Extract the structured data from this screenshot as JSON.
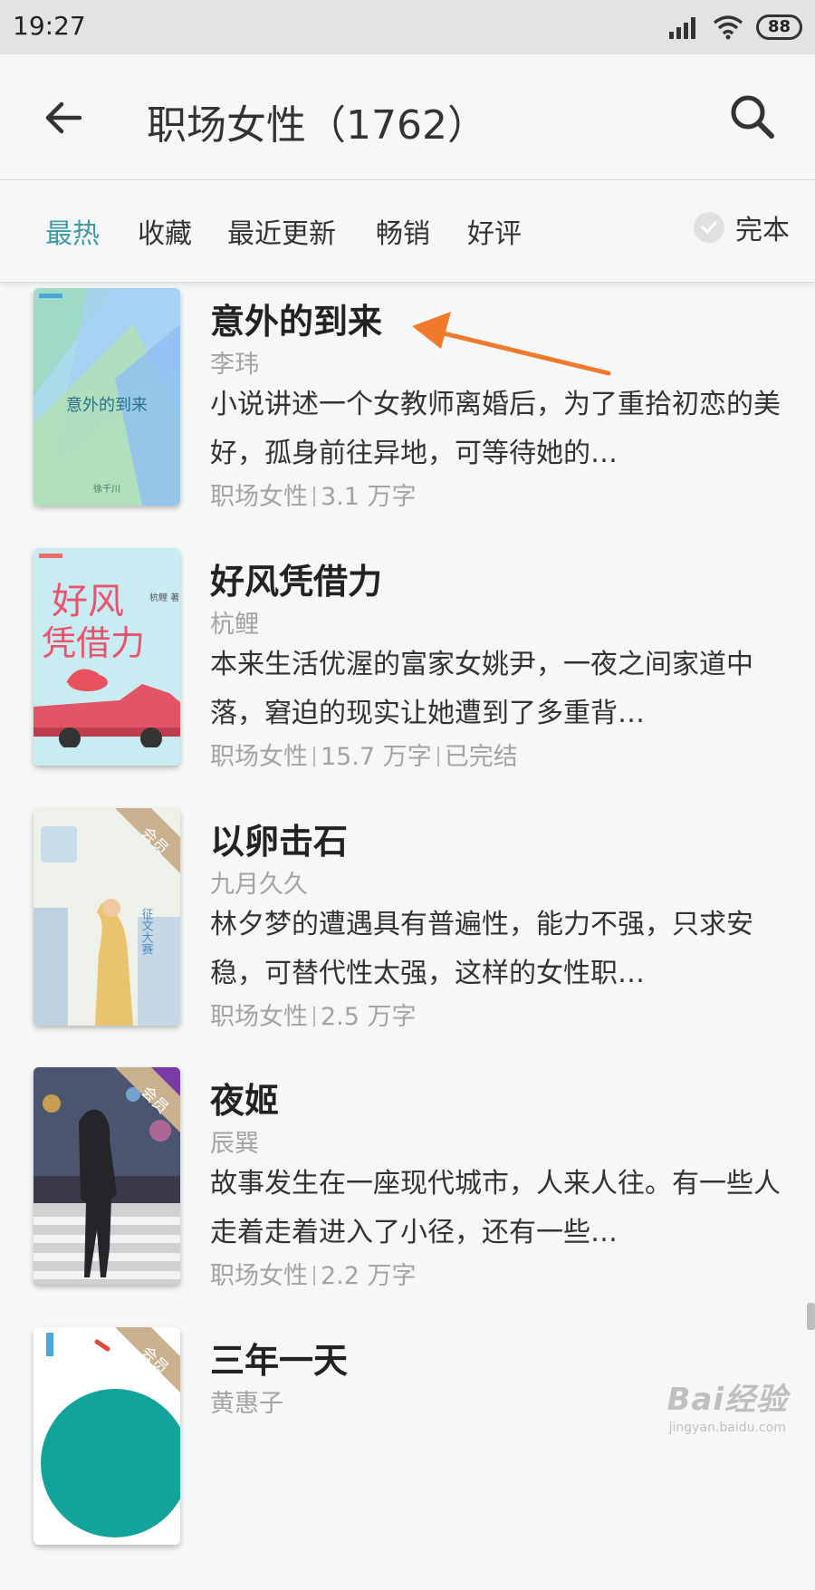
{
  "status_bar": {
    "time": "19:27",
    "battery": "88",
    "icons": [
      "signal-icon",
      "wifi-icon",
      "battery-icon"
    ]
  },
  "header": {
    "title": "职场女性（1762）",
    "back_icon": "back-arrow-icon",
    "search_icon": "search-icon"
  },
  "filters": {
    "tabs": [
      {
        "label": "最热",
        "active": true
      },
      {
        "label": "收藏",
        "active": false
      },
      {
        "label": "最近更新",
        "active": false
      },
      {
        "label": "畅销",
        "active": false
      },
      {
        "label": "好评",
        "active": false
      }
    ],
    "complete_label": "完本",
    "active_color": "#3e9aa5"
  },
  "books": [
    {
      "title": "意外的到来",
      "author": "李玮",
      "description": "小说讲述一个女教师离婚后，为了重拾初恋的美好，孤身前往异地，可等待她的…",
      "meta": [
        "职场女性",
        "3.1 万字"
      ],
      "cover_text": "意外的到来",
      "cover_sub": "徐千川"
    },
    {
      "title": "好风凭借力",
      "author": "杭鲤",
      "description": "本来生活优渥的富家女姚尹，一夜之间家道中落，窘迫的现实让她遭到了多重背…",
      "meta": [
        "职场女性",
        "15.7 万字",
        "已完结"
      ],
      "cover_text": "好风凭借力",
      "cover_sub": "杭鲤 著"
    },
    {
      "title": "以卵击石",
      "author": "九月久久",
      "description": "林夕梦的遭遇具有普遍性，能力不强，只求安稳，可替代性太强，这样的女性职…",
      "meta": [
        "职场女性",
        "2.5 万字"
      ],
      "badge": "会员",
      "cover_text": "征文大赛"
    },
    {
      "title": "夜姬",
      "author": "辰巽",
      "description": "故事发生在一座现代城市，人来人往。有一些人走着走着进入了小径，还有一些…",
      "meta": [
        "职场女性",
        "2.2 万字"
      ],
      "badge": "会员"
    },
    {
      "title": "三年一天",
      "author": "黄惠子",
      "description": "",
      "meta": [],
      "badge": "会员"
    }
  ],
  "annotation": {
    "color": "#f07a2c"
  },
  "watermark": {
    "text": "Bai经验",
    "sub": "jingyan.baidu.com"
  }
}
